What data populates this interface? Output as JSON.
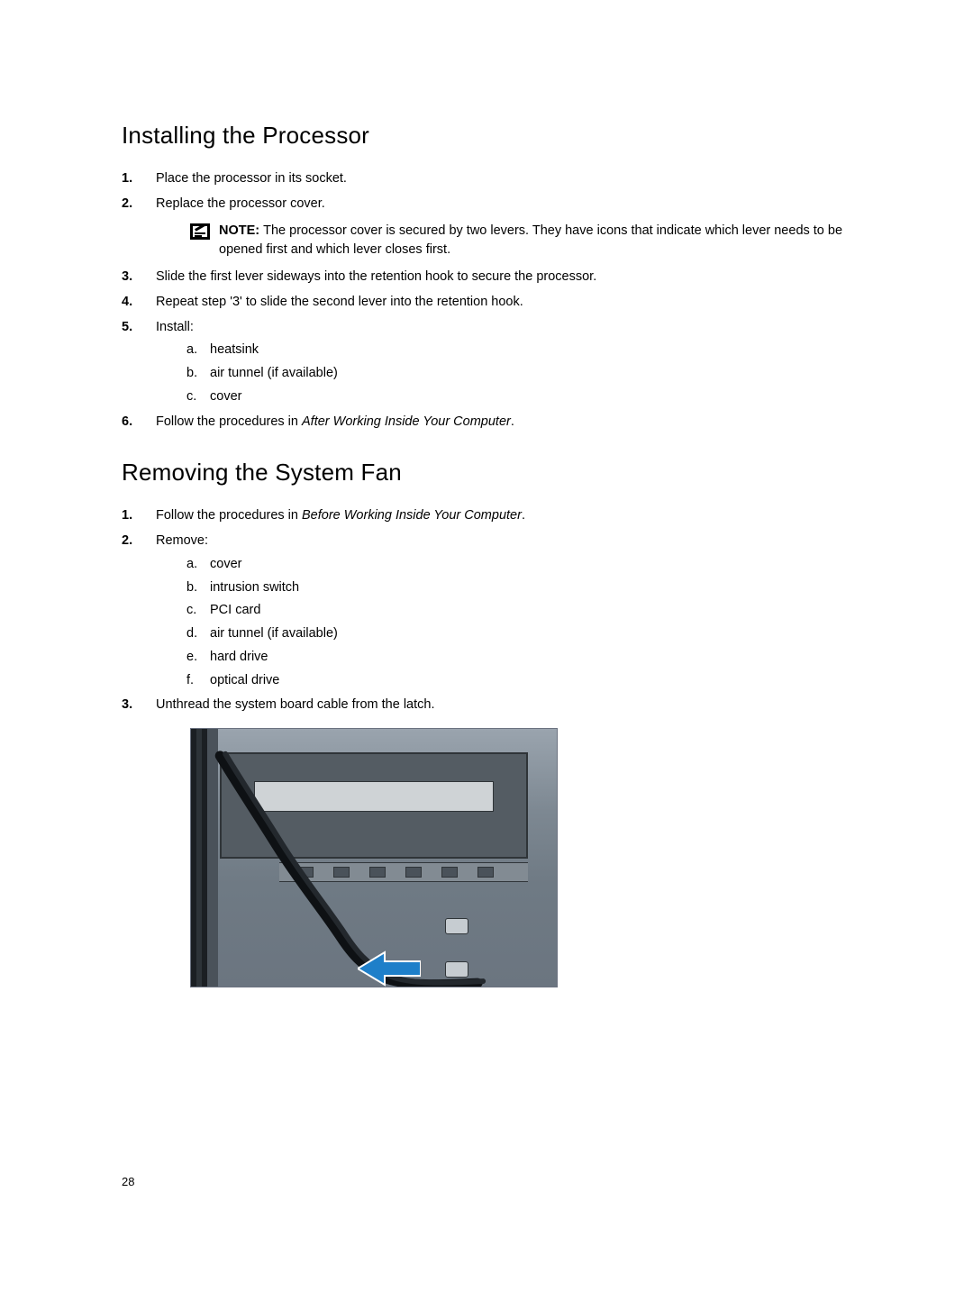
{
  "page_number": "28",
  "section1": {
    "heading": "Installing the Processor",
    "steps": [
      "Place the processor in its socket.",
      "Replace the processor cover.",
      "Slide the first lever sideways into the retention hook to secure the processor.",
      "Repeat step '3' to slide the second lever into the retention hook.",
      "Install:",
      "Follow the procedures in "
    ],
    "note_label": "NOTE: ",
    "note_text": "The processor cover is secured by two levers. They have icons that indicate which lever needs to be opened first and which lever closes first.",
    "install_items": [
      "heatsink",
      "air tunnel (if available)",
      "cover"
    ],
    "step6_italic": "After Working Inside Your Computer",
    "step6_suffix": "."
  },
  "section2": {
    "heading": "Removing the System Fan",
    "steps": [
      "Follow the procedures in ",
      "Remove:",
      "Unthread the system board cable from the latch."
    ],
    "step1_italic": "Before Working Inside Your Computer",
    "step1_suffix": ".",
    "remove_items": [
      "cover",
      "intrusion switch",
      "PCI card",
      "air tunnel (if available)",
      "hard drive",
      "optical drive"
    ]
  }
}
